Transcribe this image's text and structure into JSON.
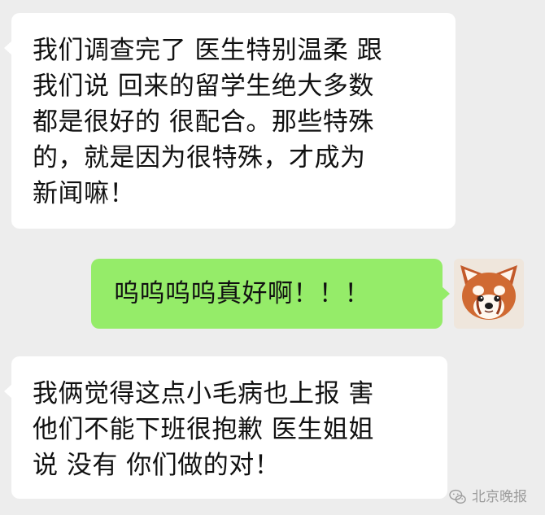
{
  "chat": {
    "messages": [
      {
        "id": "msg1",
        "side": "incoming",
        "text": "我们调查完了 医生特别温柔 跟\n我们说 回来的留学生绝大多数\n都是很好的 很配合。那些特殊\n的，就是因为很特殊，才成为\n新闻嘛！"
      },
      {
        "id": "msg2",
        "side": "outgoing",
        "text": "呜呜呜呜真好啊！！！"
      },
      {
        "id": "msg3",
        "side": "incoming",
        "text": "我俩觉得这点小毛病也上报 害\n他们不能下班很抱歉 医生姐姐\n说 没有 你们做的对！"
      }
    ],
    "avatar_icon": "red-panda-avatar-icon",
    "colors": {
      "background": "#ededed",
      "incoming_bubble": "#ffffff",
      "outgoing_bubble": "#95ec69"
    }
  },
  "watermark": {
    "icon": "wechat-icon",
    "text": "北京晚报"
  }
}
